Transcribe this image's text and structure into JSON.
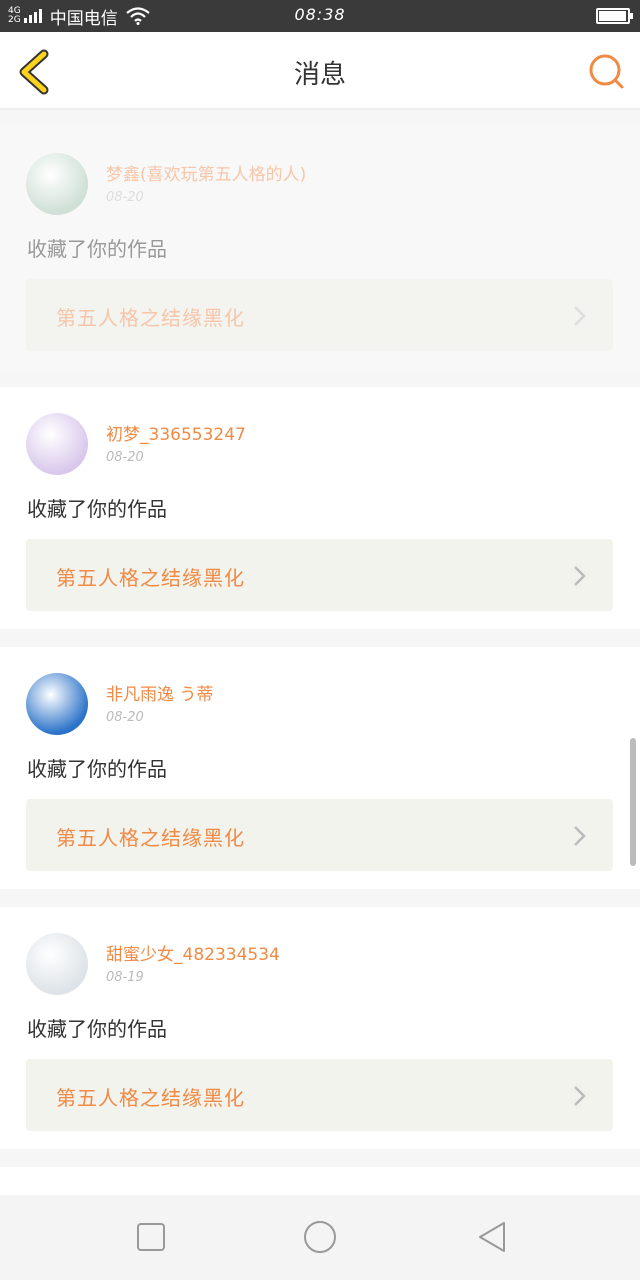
{
  "status_bar": {
    "network": [
      "4G",
      "2G"
    ],
    "carrier": "中国电信",
    "time": "08:38",
    "battery_level": 0.95
  },
  "navbar": {
    "back_icon": "chevron-left-icon",
    "title": "消息",
    "search_icon": "search-icon",
    "accent": "#f08a45"
  },
  "messages": [
    {
      "username": "梦鑫(喜欢玩第五人格的人)",
      "date": "08-20",
      "action": "收藏了你的作品",
      "work_title": "第五人格之结缘黑化",
      "avatar_color": "#cfe0d6"
    },
    {
      "username": "初梦_336553247",
      "date": "08-20",
      "action": "收藏了你的作品",
      "work_title": "第五人格之结缘黑化",
      "avatar_color": "#d9c8ec"
    },
    {
      "username": "非凡雨逸 う蒂",
      "date": "08-20",
      "action": "收藏了你的作品",
      "work_title": "第五人格之结缘黑化",
      "avatar_color": "#2d74c9"
    },
    {
      "username": "甜蜜少女_482334534",
      "date": "08-19",
      "action": "收藏了你的作品",
      "work_title": "第五人格之结缘黑化",
      "avatar_color": "#dde3e8"
    }
  ]
}
